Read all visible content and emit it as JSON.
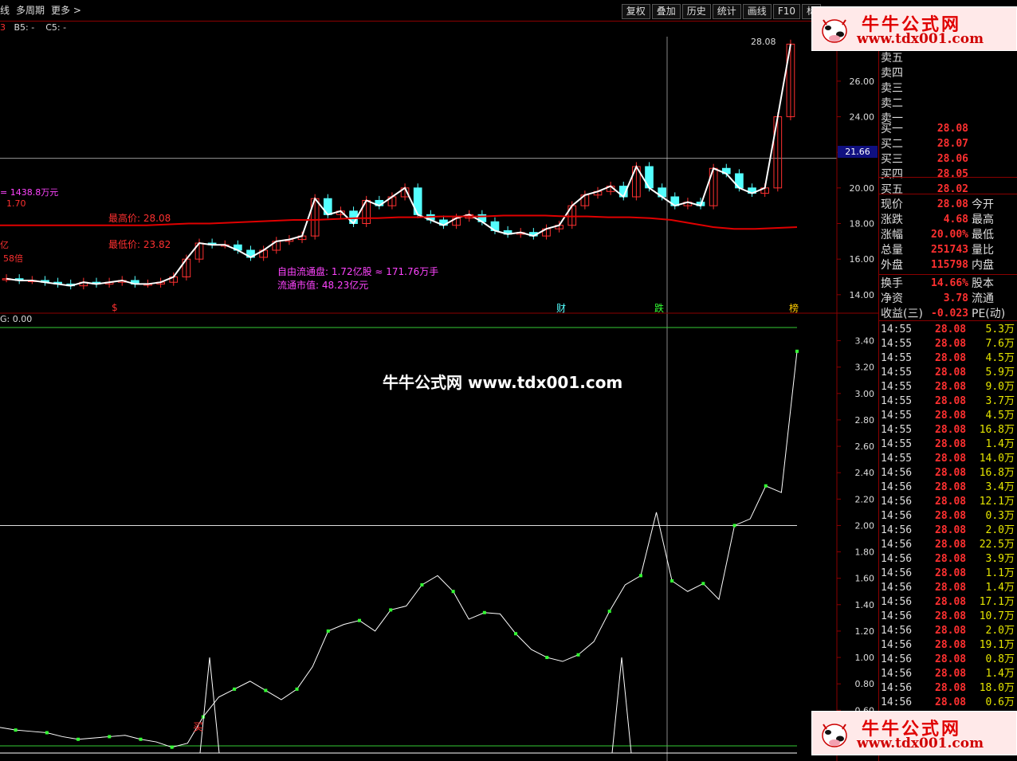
{
  "toolbar": {
    "left_items": [
      "线",
      "多周期",
      "更多 >"
    ],
    "buttons": [
      "复权",
      "叠加",
      "历史",
      "统计",
      "画线",
      "F10",
      "标"
    ]
  },
  "indicator_header": {
    "b5": "B5: -",
    "c5": "C5: -"
  },
  "logo": {
    "title": "牛牛公式网",
    "url": "www.tdx001.com"
  },
  "watermark": "牛牛公式网 www.tdx001.com",
  "main_chart": {
    "y_ticks": [
      "26.00",
      "24.00",
      "22.00",
      "20.00",
      "18.00",
      "16.00",
      "14.00"
    ],
    "crosshair_price": "21.66",
    "peak_label": "28.08",
    "notes": {
      "amount": "= 1438.8万元",
      "p170": "1.70",
      "yi": "亿",
      "bei": "58倍",
      "high": "最高价: 28.08",
      "low": "最低价: 23.82",
      "float_shares": "自由流通盘: 1.72亿股 ≈ 171.76万手",
      "float_cap": "流通市值: 48.23亿元"
    },
    "markers": {
      "s": "$",
      "cai": "财",
      "die": "跌",
      "bang": "榜"
    }
  },
  "sub_chart": {
    "header": "G: 0.00",
    "y_ticks": [
      "3.40",
      "3.20",
      "3.00",
      "2.80",
      "2.60",
      "2.40",
      "2.20",
      "2.00",
      "1.80",
      "1.60",
      "1.40",
      "1.20",
      "1.00",
      "0.80",
      "0.60",
      "0.40"
    ],
    "buy_label": "买"
  },
  "chart_data": {
    "type": "line",
    "main": {
      "y_range": [
        13.5,
        28.5
      ],
      "close": [
        14.9,
        14.8,
        14.8,
        14.7,
        14.6,
        14.5,
        14.7,
        14.6,
        14.7,
        14.8,
        14.6,
        14.6,
        14.7,
        15.0,
        16.0,
        16.9,
        16.8,
        16.8,
        16.5,
        16.1,
        16.5,
        17.0,
        17.1,
        17.3,
        19.4,
        18.5,
        18.7,
        18.0,
        19.3,
        19.0,
        19.5,
        20.0,
        18.5,
        18.2,
        17.9,
        18.3,
        18.5,
        18.1,
        17.6,
        17.4,
        17.5,
        17.3,
        17.7,
        17.9,
        19.0,
        19.6,
        19.8,
        20.1,
        19.5,
        21.2,
        20.0,
        19.5,
        19.0,
        19.2,
        19.0,
        21.1,
        20.8,
        20.0,
        19.7,
        20.0,
        24.0,
        28.08
      ],
      "ma": [
        17.9,
        17.9,
        17.9,
        17.9,
        17.9,
        17.9,
        17.9,
        17.9,
        17.95,
        18.0,
        18.0,
        18.05,
        18.1,
        18.15,
        18.2,
        18.2,
        18.25,
        18.3,
        18.3,
        18.35,
        18.35,
        18.4,
        18.4,
        18.4,
        18.45,
        18.45,
        18.45,
        18.4,
        18.4,
        18.35,
        18.35,
        18.3,
        18.2,
        18.0,
        17.8,
        17.7,
        17.7,
        17.75,
        17.8
      ],
      "y_axis_ticks": [
        26,
        24,
        22,
        20,
        18,
        16,
        14
      ]
    },
    "sub": {
      "y_range": [
        0.3,
        3.5
      ],
      "values": [
        0.47,
        0.45,
        0.44,
        0.43,
        0.4,
        0.38,
        0.39,
        0.4,
        0.41,
        0.38,
        0.36,
        0.32,
        0.35,
        0.55,
        0.7,
        0.76,
        0.82,
        0.75,
        0.68,
        0.76,
        0.93,
        1.2,
        1.25,
        1.28,
        1.2,
        1.36,
        1.39,
        1.55,
        1.62,
        1.5,
        1.29,
        1.34,
        1.33,
        1.18,
        1.06,
        1.0,
        0.97,
        1.02,
        1.12,
        1.35,
        1.55,
        1.62,
        2.1,
        1.58,
        1.5,
        1.56,
        1.44,
        2.0,
        2.05,
        2.3,
        2.25,
        3.32
      ],
      "spike_x": [
        0.263,
        0.78
      ],
      "upper_line": 3.5,
      "mid_line": 2.0,
      "lower_line": 0.33
    }
  },
  "quote_panel": {
    "sell": [
      {
        "k": "卖五",
        "v": ""
      },
      {
        "k": "卖四",
        "v": ""
      },
      {
        "k": "卖三",
        "v": ""
      },
      {
        "k": "卖二",
        "v": ""
      },
      {
        "k": "卖一",
        "v": ""
      }
    ],
    "buy": [
      {
        "k": "买一",
        "v": "28.08"
      },
      {
        "k": "买二",
        "v": "28.07"
      },
      {
        "k": "买三",
        "v": "28.06"
      },
      {
        "k": "买四",
        "v": "28.05"
      },
      {
        "k": "买五",
        "v": "28.02"
      }
    ],
    "stats": [
      {
        "k": "现价",
        "v": "28.08",
        "k2": "今开"
      },
      {
        "k": "涨跌",
        "v": "4.68",
        "k2": "最高"
      },
      {
        "k": "涨幅",
        "v": "20.00%",
        "k2": "最低"
      },
      {
        "k": "总量",
        "v": "251743",
        "k2": "量比"
      },
      {
        "k": "外盘",
        "v": "115798",
        "k2": "内盘"
      },
      {
        "k": "换手",
        "v": "14.66%",
        "k2": "股本"
      },
      {
        "k": "净资",
        "v": "3.78",
        "k2": "流通"
      },
      {
        "k": "收益(三)",
        "v": "-0.023",
        "k2": "PE(动)"
      }
    ],
    "ticks": [
      {
        "t": "14:55",
        "p": "28.08",
        "v": "5.3万"
      },
      {
        "t": "14:55",
        "p": "28.08",
        "v": "7.6万"
      },
      {
        "t": "14:55",
        "p": "28.08",
        "v": "4.5万"
      },
      {
        "t": "14:55",
        "p": "28.08",
        "v": "5.9万"
      },
      {
        "t": "14:55",
        "p": "28.08",
        "v": "9.0万"
      },
      {
        "t": "14:55",
        "p": "28.08",
        "v": "3.7万"
      },
      {
        "t": "14:55",
        "p": "28.08",
        "v": "4.5万"
      },
      {
        "t": "14:55",
        "p": "28.08",
        "v": "16.8万"
      },
      {
        "t": "14:55",
        "p": "28.08",
        "v": "1.4万"
      },
      {
        "t": "14:55",
        "p": "28.08",
        "v": "14.0万"
      },
      {
        "t": "14:56",
        "p": "28.08",
        "v": "16.8万"
      },
      {
        "t": "14:56",
        "p": "28.08",
        "v": "3.4万"
      },
      {
        "t": "14:56",
        "p": "28.08",
        "v": "12.1万"
      },
      {
        "t": "14:56",
        "p": "28.08",
        "v": "0.3万"
      },
      {
        "t": "14:56",
        "p": "28.08",
        "v": "2.0万"
      },
      {
        "t": "14:56",
        "p": "28.08",
        "v": "22.5万"
      },
      {
        "t": "14:56",
        "p": "28.08",
        "v": "3.9万"
      },
      {
        "t": "14:56",
        "p": "28.08",
        "v": "1.1万"
      },
      {
        "t": "14:56",
        "p": "28.08",
        "v": "1.4万"
      },
      {
        "t": "14:56",
        "p": "28.08",
        "v": "17.1万"
      },
      {
        "t": "14:56",
        "p": "28.08",
        "v": "10.7万"
      },
      {
        "t": "14:56",
        "p": "28.08",
        "v": "2.0万"
      },
      {
        "t": "14:56",
        "p": "28.08",
        "v": "19.1万"
      },
      {
        "t": "14:56",
        "p": "28.08",
        "v": "0.8万"
      },
      {
        "t": "14:56",
        "p": "28.08",
        "v": "1.4万"
      },
      {
        "t": "14:56",
        "p": "28.08",
        "v": "18.0万"
      },
      {
        "t": "14:56",
        "p": "28.08",
        "v": "0.6万"
      }
    ]
  },
  "colors": {
    "up": "#ff3030",
    "down": "#54ffff",
    "ma": "#e00000",
    "line": "#ffffff",
    "dot": "#33ff33",
    "hline": "#33cc33",
    "border": "#8b0000"
  }
}
